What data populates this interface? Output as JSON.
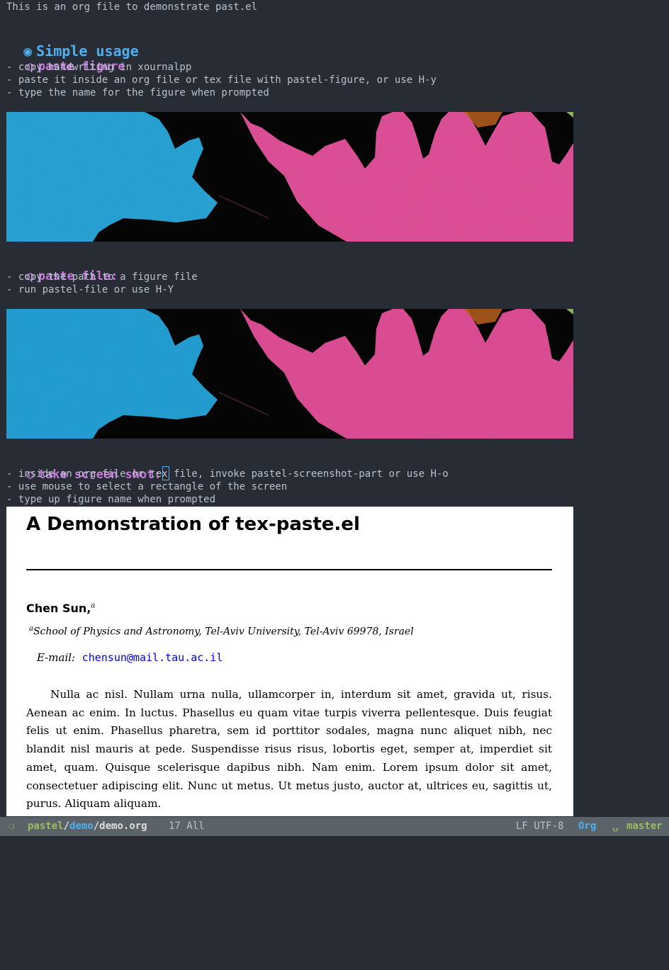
{
  "buffer": {
    "intro": "This is an org file to demonstrate past.el",
    "heading_bullet_1": "◉",
    "heading_1": "Simple usage",
    "section_bullet": "○",
    "sections": [
      {
        "title": "paste figure",
        "items": [
          "- copy handwriting in xournalpp",
          "- paste it inside an org file or tex file with pastel-figure, or use H-y",
          "- type the name for the figure when prompted"
        ]
      },
      {
        "title": "paste file:",
        "items": [
          "- copy the path to a figure file",
          "- run pastel-file or use H-Y"
        ]
      },
      {
        "title": "take screen shot:",
        "items": [
          "- inside an org file or tex file, invoke pastel-screenshot-part or use H-o",
          "- use mouse to select a rectangle of the screen",
          "- type up figure name when prompted"
        ]
      }
    ]
  },
  "screenshot": {
    "title": "A Demonstration of tex-paste.el",
    "author": "Chen Sun,",
    "author_sup": "a",
    "affiliation_sup": "a",
    "affiliation": "School of Physics and Astronomy, Tel-Aviv University, Tel-Aviv 69978, Israel",
    "email_label": "E-mail:",
    "email": "chensun@mail.tau.ac.il",
    "body": "Nulla ac nisl. Nullam urna nulla, ullamcorper in, interdum sit amet, gravida ut, risus. Aenean ac enim. In luctus. Phasellus eu quam vitae turpis viverra pellentesque. Duis feugiat felis ut enim. Phasellus pharetra, sem id porttitor sodales, magna nunc aliquet nibh, nec blandit nisl mauris at pede. Suspendisse risus risus, lobortis eget, semper at, imperdiet sit amet, quam. Quisque scelerisque dapibus nibh. Nam enim. Lorem ipsum dolor sit amet, consectetuer adipiscing elit. Nunc ut metus. Ut metus justo, auctor at, ultrices eu, sagittis ut, purus. Aliquam aliquam."
  },
  "modeline": {
    "status_icon": "❍",
    "path_project": "pastel",
    "path_sep": "/",
    "path_dir": "demo",
    "path_file": "demo.org",
    "position": "17 All",
    "encoding": "LF UTF-8",
    "major_mode": "Org",
    "vcs_icon": "⍽",
    "branch": "master"
  },
  "colors": {
    "background": "#282c34",
    "heading_1": "#51afef",
    "heading_2": "#c678dd",
    "modeline_bg": "#5b6268",
    "accent_green": "#98be65",
    "figure_cyan": "#29a8d8",
    "figure_pink": "#e8579a"
  }
}
